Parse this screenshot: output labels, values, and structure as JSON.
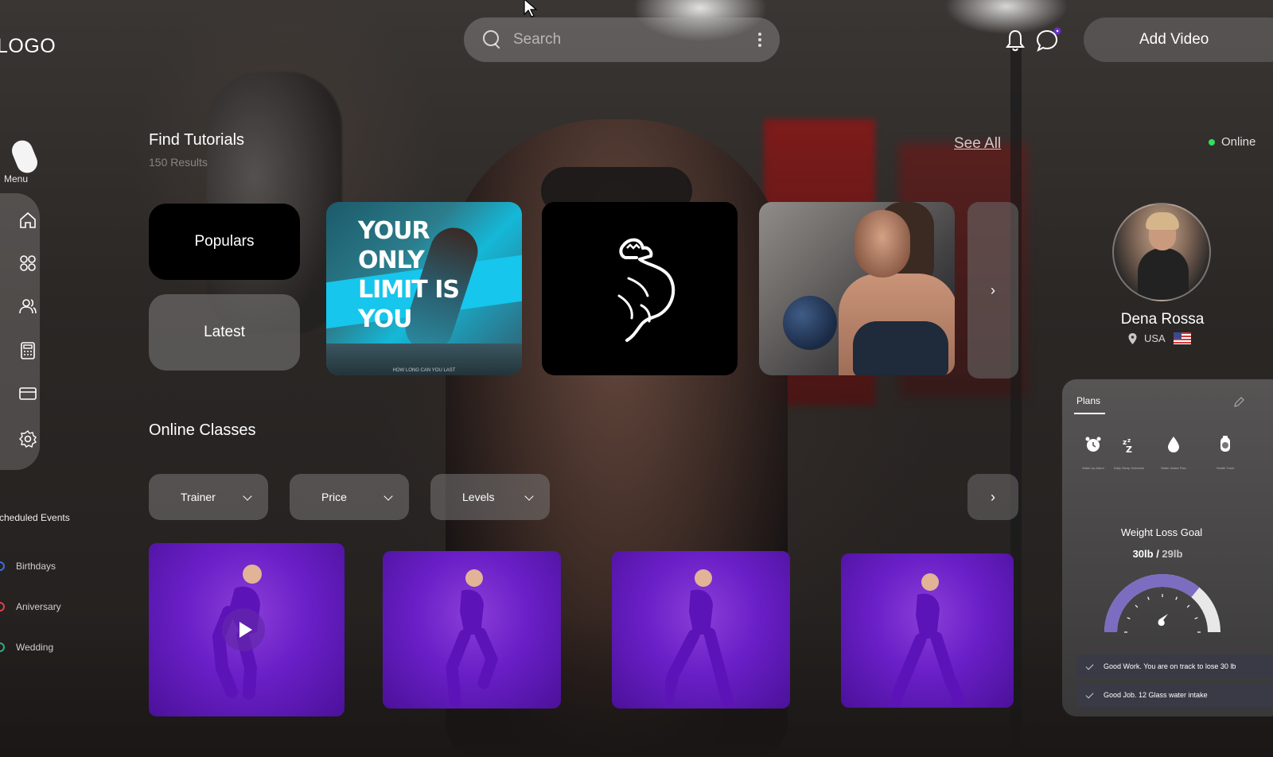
{
  "header": {
    "logo": "LOGO",
    "search_placeholder": "Search",
    "add_video_label": "Add Video"
  },
  "sidebar": {
    "menu_label": "Menu",
    "items": [
      {
        "icon": "home-icon"
      },
      {
        "icon": "grid-icon"
      },
      {
        "icon": "users-icon"
      },
      {
        "icon": "calculator-icon"
      },
      {
        "icon": "card-icon"
      },
      {
        "icon": "settings-icon"
      }
    ],
    "scheduled_events_title": "Scheduled Events",
    "events": [
      {
        "label": "Birthdays",
        "color": "#3b6fe0"
      },
      {
        "label": "Aniversary",
        "color": "#e0404a"
      },
      {
        "label": "Wedding",
        "color": "#2fae7a"
      }
    ]
  },
  "tutorials": {
    "title": "Find Tutorials",
    "results": "150 Results",
    "see_all": "See All",
    "popular_label": "Populars",
    "latest_label": "Latest",
    "motivation_words": [
      "YOUR",
      "ONLY",
      "LIMIT IS",
      "YOU"
    ],
    "motivation_footer": "HOW LONG CAN YOU LAST"
  },
  "classes": {
    "title": "Online Classes",
    "filters": [
      "Trainer",
      "Price",
      "Levels"
    ]
  },
  "profile": {
    "online_label": "Online",
    "name": "Dena Rossa",
    "country": "USA"
  },
  "plans": {
    "tab_label": "Plans",
    "items": [
      {
        "icon": "alarm-clock-icon",
        "label": "Wake Up Alarm"
      },
      {
        "icon": "sleep-icon",
        "label": "Daily Sleep Schedule"
      },
      {
        "icon": "water-drop-icon",
        "label": "Water Intake Plan"
      },
      {
        "icon": "health-icon",
        "label": "Health Track"
      }
    ],
    "goal_title": "Weight Loss Goal",
    "goal_current": "30lb",
    "goal_separator": " / ",
    "goal_target": "29lb",
    "goal_progress": 0.72,
    "notes": [
      "Good Work. You are on track to lose 30 lb",
      "Good Job. 12 Glass water intake"
    ]
  },
  "colors": {
    "accent_purple": "#6a1fc7",
    "online_green": "#2fe05a"
  }
}
